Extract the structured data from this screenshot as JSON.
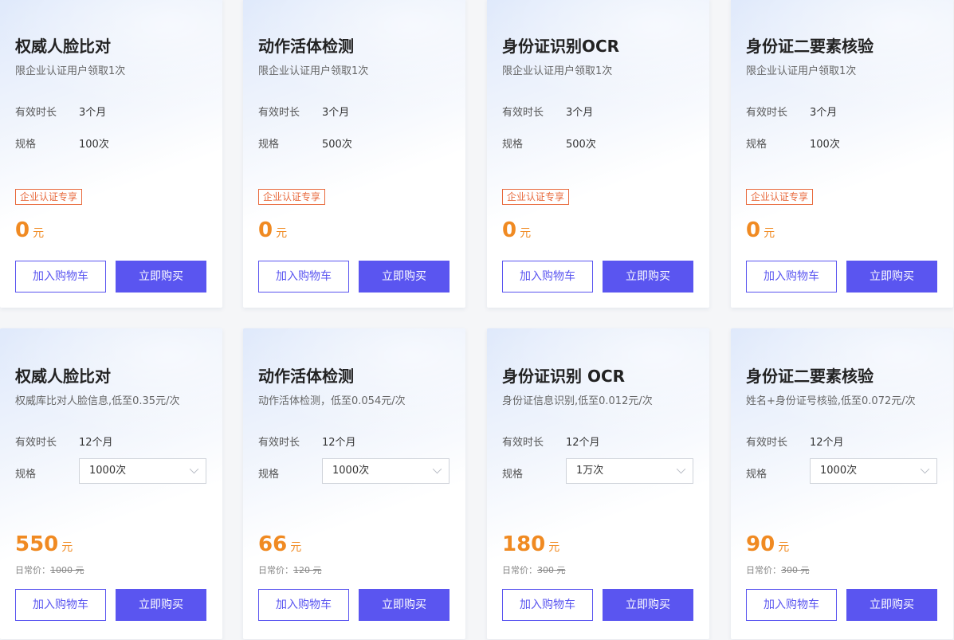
{
  "colors": {
    "accent": "#5a55f0",
    "price": "#f08a22",
    "tag": "#e8693c"
  },
  "labels": {
    "duration": "有效时长",
    "spec": "规格",
    "price_unit": "元",
    "orig_prefix": "日常价：",
    "add_to_cart": "加入购物车",
    "buy_now": "立即购买"
  },
  "free_cards": [
    {
      "title": "权威人脸比对",
      "desc": "限企业认证用户领取1次",
      "duration": "3个月",
      "spec": "100次",
      "tag": "企业认证专享",
      "price": "0"
    },
    {
      "title": "动作活体检测",
      "desc": "限企业认证用户领取1次",
      "duration": "3个月",
      "spec": "500次",
      "tag": "企业认证专享",
      "price": "0"
    },
    {
      "title": "身份证识别OCR",
      "desc": "限企业认证用户领取1次",
      "duration": "3个月",
      "spec": "500次",
      "tag": "企业认证专享",
      "price": "0"
    },
    {
      "title": "身份证二要素核验",
      "desc": "限企业认证用户领取1次",
      "duration": "3个月",
      "spec": "100次",
      "tag": "企业认证专享",
      "price": "0"
    }
  ],
  "paid_cards": [
    {
      "title": "权威人脸比对",
      "desc": "权威库比对人脸信息,低至0.35元/次",
      "duration": "12个月",
      "spec_selected": "1000次",
      "price": "550",
      "orig_price": "1000 元"
    },
    {
      "title": "动作活体检测",
      "desc": "动作活体检测，低至0.054元/次",
      "duration": "12个月",
      "spec_selected": "1000次",
      "price": "66",
      "orig_price": "120 元"
    },
    {
      "title": "身份证识别 OCR",
      "desc": "身份证信息识别,低至0.012元/次",
      "duration": "12个月",
      "spec_selected": "1万次",
      "price": "180",
      "orig_price": "300 元"
    },
    {
      "title": "身份证二要素核验",
      "desc": "姓名+身份证号核验,低至0.072元/次",
      "duration": "12个月",
      "spec_selected": "1000次",
      "price": "90",
      "orig_price": "300 元"
    }
  ]
}
